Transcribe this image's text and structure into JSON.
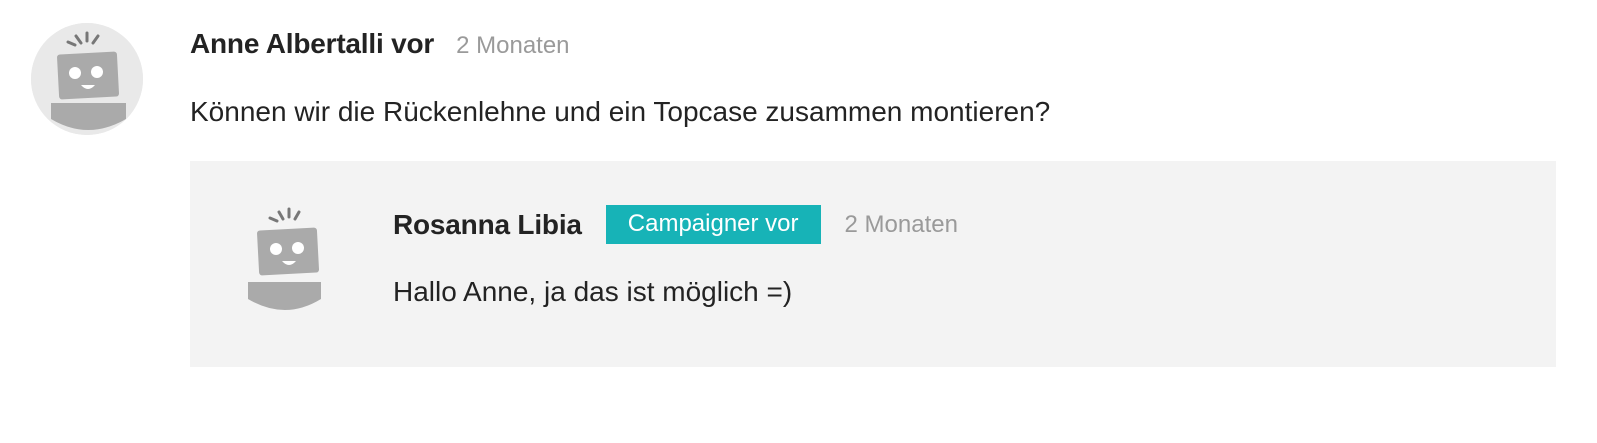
{
  "comment": {
    "author": "Anne Albertalli vor",
    "time": "2 Monaten",
    "text": "Können wir die Rückenlehne und ein Topcase zusammen montieren?",
    "avatar_icon": "robot-avatar-icon"
  },
  "reply": {
    "author": "Rosanna Libia",
    "badge": "Campaigner vor",
    "time": "2 Monaten",
    "text": "Hallo Anne, ja das ist möglich =)",
    "avatar_icon": "robot-avatar-icon"
  },
  "colors": {
    "badge_bg": "#17b3b7",
    "reply_bg": "#f3f3f3",
    "muted_text": "#9a9a9a"
  }
}
